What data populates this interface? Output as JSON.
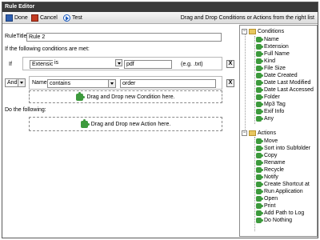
{
  "window": {
    "title": "Rule Editor"
  },
  "toolbar": {
    "done_label": "Done",
    "cancel_label": "Cancel",
    "test_label": "Test",
    "hint": "Drag and Drop Conditions or Actions from the right list"
  },
  "rule": {
    "title_label": "RuleTitle:",
    "title_value": "Rule 2"
  },
  "conditions_intro": "If the following conditions are met:",
  "condition1": {
    "prefix": "If",
    "field": "Extension",
    "operator": "is",
    "value": "pdf",
    "hint": "(e.g. .txt)",
    "remove": "X"
  },
  "condition2": {
    "join": "And",
    "field": "Name",
    "operator": "contains",
    "value": "order",
    "remove": "X"
  },
  "drop_condition": "Drag and Drop new Condition here.",
  "actions_intro": "Do the following:",
  "drop_action": "Drag and Drop new Action here.",
  "tree": {
    "conditions_label": "Conditions",
    "conditions": [
      "Name",
      "Extension",
      "Full Name",
      "Kind",
      "File Size",
      "Date Created",
      "Date Last Modified",
      "Date Last Accessed",
      "Folder",
      "Mp3 Tag",
      "Exif Info",
      "Any"
    ],
    "actions_label": "Actions",
    "actions": [
      "Move",
      "Sort into Subfolder",
      "Copy",
      "Rename",
      "Recycle",
      "Notify",
      "Create Shortcut at",
      "Run Application",
      "Open",
      "Print",
      "Add Path to Log",
      "Do Nothing"
    ],
    "collapse_glyph": "−"
  }
}
